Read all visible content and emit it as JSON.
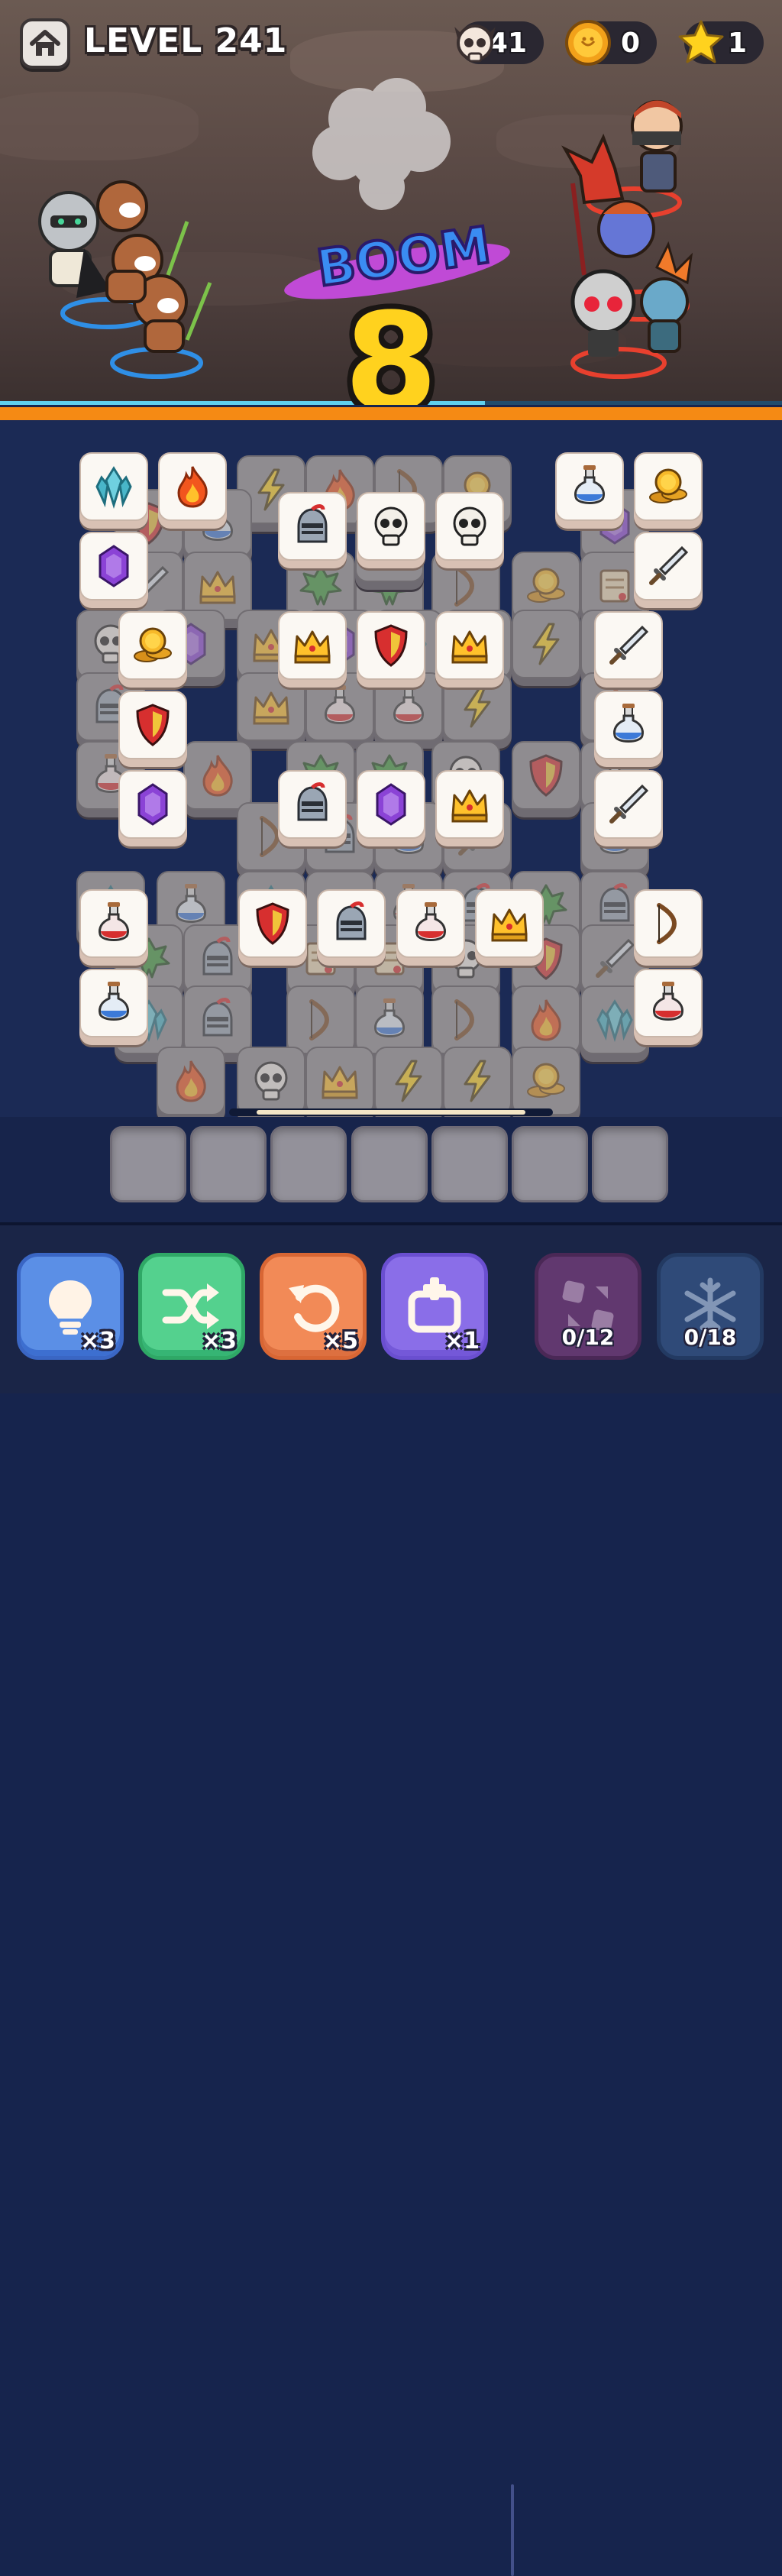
{
  "header": {
    "level_label": "LEVEL 241",
    "skulls": "41",
    "coins": "0",
    "stars": "1"
  },
  "battle": {
    "boom_text": "BOOM",
    "combo": "8",
    "hp_fraction": 0.62
  },
  "icons": [
    "crystal",
    "fire",
    "bolt",
    "bow",
    "coin",
    "potion-blue",
    "potion-red",
    "gem",
    "sword",
    "skull",
    "helmet",
    "crown",
    "shield",
    "leaf",
    "scroll"
  ],
  "board": {
    "lower_tiles": [
      "bolt",
      "fire",
      "bow",
      "coin",
      "shield",
      "potion-blue",
      "gem",
      "sword",
      "crown",
      "leaf",
      "leaf",
      "bolt",
      "bow",
      "coin",
      "scroll",
      "skull",
      "gem",
      "crown",
      "gem",
      "crystal",
      "potion-red",
      "bolt",
      "potion-red",
      "helmet",
      "crown",
      "potion-red",
      "potion-red",
      "bolt",
      "fire",
      "potion-red",
      "fire",
      "leaf",
      "leaf",
      "skull",
      "shield",
      "potion-blue",
      "bow",
      "helmet",
      "potion-blue",
      "sword",
      "potion-blue",
      "crystal",
      "potion-blue",
      "crystal",
      "crown",
      "potion-red",
      "helmet",
      "leaf",
      "helmet",
      "leaf",
      "helmet",
      "scroll",
      "scroll",
      "skull",
      "shield",
      "sword",
      "crystal",
      "helmet",
      "bow",
      "potion-blue",
      "bow",
      "fire",
      "crystal",
      "fire",
      "skull",
      "crown",
      "bolt",
      "bolt",
      "coin"
    ],
    "top_tiles": [
      "crystal",
      "fire",
      "potion-blue",
      "coin",
      "helmet",
      "skull",
      "skull",
      "gem",
      "sword",
      "coin",
      "crown",
      "shield",
      "crown",
      "sword",
      "shield",
      "potion-blue",
      "gem",
      "helmet",
      "gem",
      "crown",
      "sword",
      "potion-red",
      "shield",
      "helmet",
      "potion-red",
      "crown",
      "bow",
      "potion-blue",
      "potion-red"
    ]
  },
  "tray": {
    "slots": 7
  },
  "toolbar": {
    "tools": [
      {
        "icon": "lightbulb",
        "count": "×3",
        "color": "#5b8fe6"
      },
      {
        "icon": "shuffle",
        "count": "×3",
        "color": "#54d18e"
      },
      {
        "icon": "undo",
        "count": "×5",
        "color": "#f28a57"
      },
      {
        "icon": "add-slot",
        "count": "×1",
        "color": "#8a6ee8"
      }
    ],
    "locked": [
      {
        "icon": "magnet",
        "progress": "0/12",
        "color": "#61386f"
      },
      {
        "icon": "snowflake",
        "progress": "0/18",
        "color": "#2f4a78"
      }
    ]
  }
}
